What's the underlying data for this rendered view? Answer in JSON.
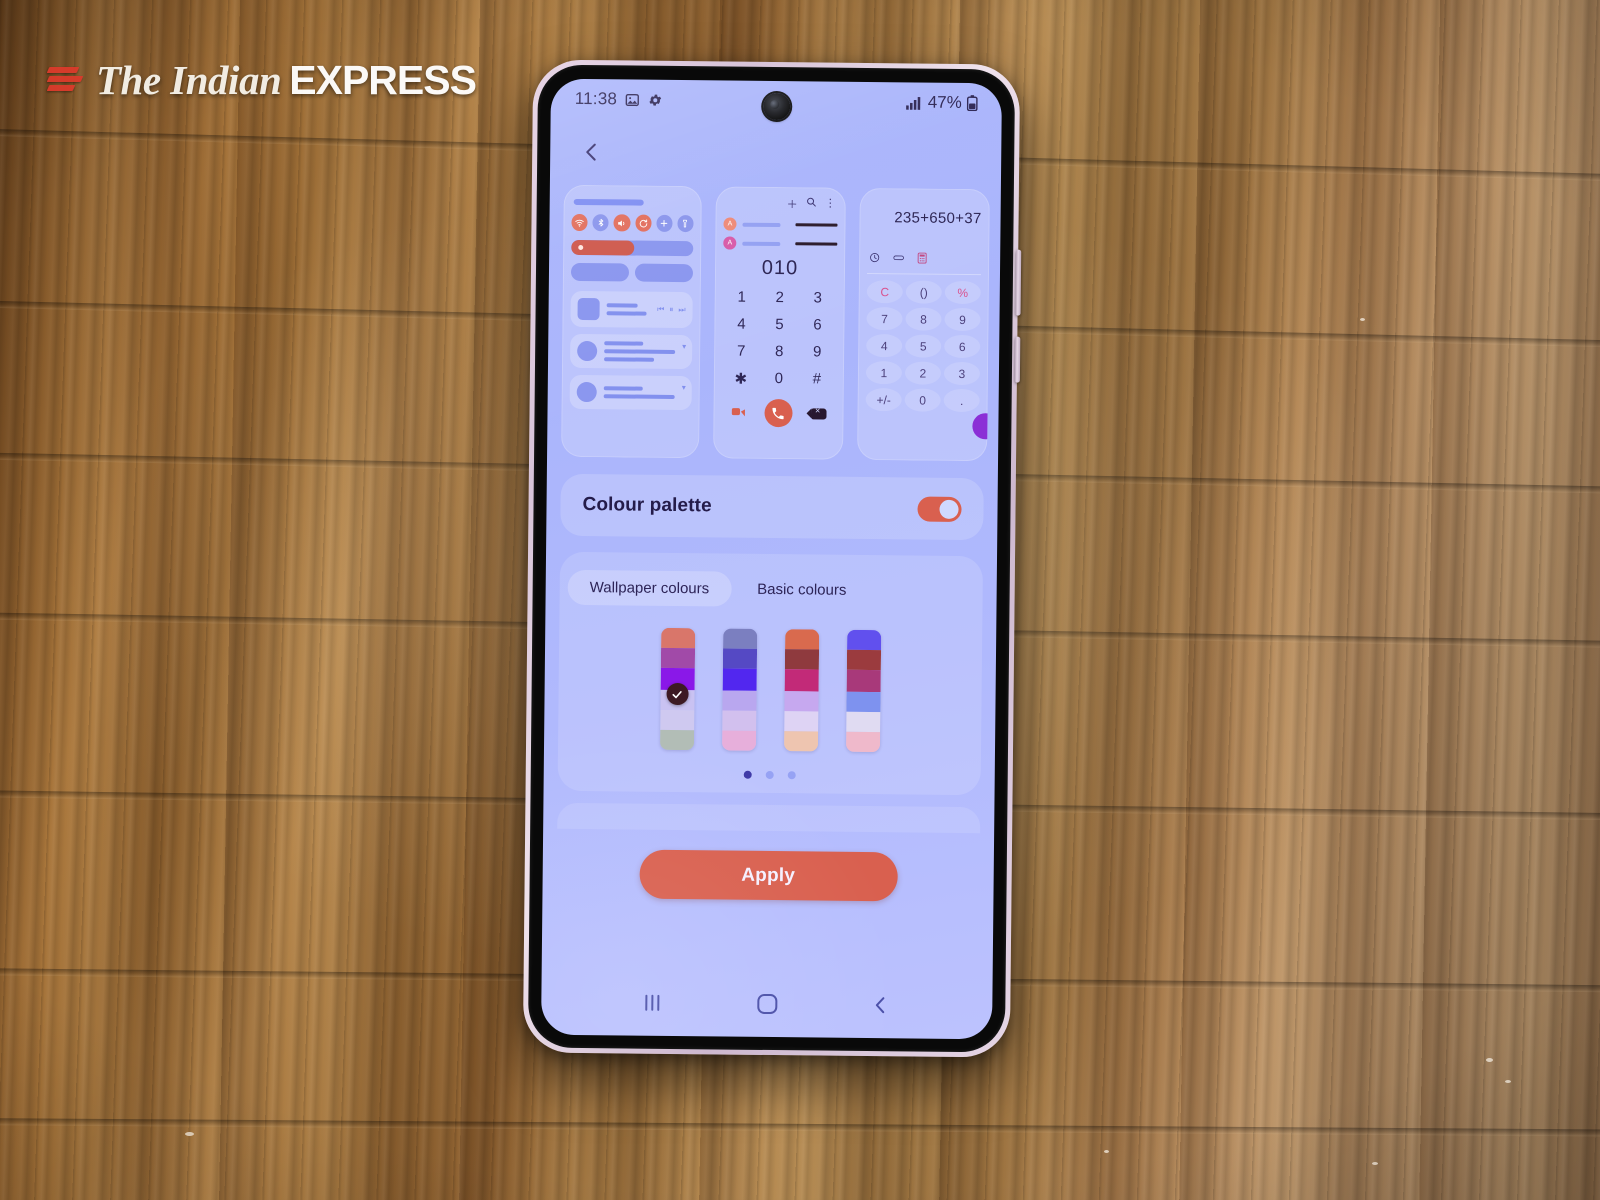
{
  "watermark": {
    "the": "The Indian",
    "express": "EXPRESS",
    "logo_icon": "indian-express-logo-icon",
    "accent": "#d93b2b"
  },
  "device": {
    "frame_color": "#e2d0e2",
    "screen_bg": "#aab5fc"
  },
  "status_bar": {
    "time": "11:38",
    "icons": [
      "image-icon",
      "gear-icon"
    ],
    "signal_icon": "signal-bars-icon",
    "battery_text": "47%",
    "battery_icon": "battery-icon",
    "camera": "front-camera-punch-hole"
  },
  "top_bar": {
    "back_icon": "chevron-left-icon"
  },
  "previews": {
    "quick_panel": {
      "name": "quick-panel-preview",
      "toggles": [
        {
          "icon": "wifi-icon",
          "color": "red"
        },
        {
          "icon": "bluetooth-icon",
          "color": "blue"
        },
        {
          "icon": "sound-icon",
          "color": "red"
        },
        {
          "icon": "sync-icon",
          "color": "red"
        },
        {
          "icon": "plus-icon",
          "color": "blue"
        },
        {
          "icon": "flashlight-icon",
          "color": "blue"
        }
      ],
      "brightness_percent": 52,
      "media_controls": [
        "prev-icon",
        "pause-icon",
        "next-icon"
      ]
    },
    "dialer": {
      "name": "dialer-preview",
      "top_icons": [
        "plus-icon",
        "search-icon",
        "more-vertical-icon"
      ],
      "contacts": [
        {
          "avatar_letter": "A",
          "color": "#ee8a78"
        },
        {
          "avatar_letter": "A",
          "color": "#d75aa8"
        }
      ],
      "number": "010",
      "keys": [
        "1",
        "2",
        "3",
        "4",
        "5",
        "6",
        "7",
        "8",
        "9",
        "✱",
        "0",
        "#"
      ],
      "actions": [
        "video-call-icon",
        "call-button",
        "backspace-icon"
      ]
    },
    "calculator": {
      "name": "calculator-preview",
      "expression": "235+650+37",
      "tools": [
        "history-icon",
        "unit-convert-icon",
        "calculator-icon"
      ],
      "keys": [
        "C",
        "()",
        "%",
        "7",
        "8",
        "9",
        "4",
        "5",
        "6",
        "1",
        "2",
        "3",
        "+/-",
        "0",
        "."
      ],
      "accent_keys": [
        "C",
        "%"
      ],
      "equals_icon": "equals-button"
    }
  },
  "colour_palette_row": {
    "label": "Colour palette",
    "toggle_on": true,
    "toggle_color": "#d9604f"
  },
  "palette_panel": {
    "tabs": [
      {
        "label": "Wallpaper colours",
        "active": true
      },
      {
        "label": "Basic colours",
        "active": false
      }
    ],
    "swatches": [
      {
        "name": "swatch-1",
        "selected": true,
        "bands": [
          "#d9766a",
          "#a14aa8",
          "#8a18e8",
          "#c9c2f2",
          "#cfc9f0",
          "#b2bdb6"
        ]
      },
      {
        "name": "swatch-2",
        "selected": false,
        "bands": [
          "#7b7fc0",
          "#5549c4",
          "#5227ef",
          "#b9a7ef",
          "#d2c0ee",
          "#e7afdb"
        ]
      },
      {
        "name": "swatch-3",
        "selected": false,
        "bands": [
          "#d96a4e",
          "#8f3a3e",
          "#c22a78",
          "#c6a8ef",
          "#ded3f4",
          "#eec5b0"
        ]
      },
      {
        "name": "swatch-4",
        "selected": false,
        "bands": [
          "#6150ee",
          "#9b3b3e",
          "#a8397a",
          "#7e92ef",
          "#e0dbf2",
          "#efb9cb"
        ]
      }
    ],
    "check_icon": "check-icon",
    "page_dots": {
      "count": 3,
      "active_index": 0
    }
  },
  "apply": {
    "label": "Apply",
    "color": "#d9604f"
  },
  "nav_bar": {
    "recents_icon": "recents-icon",
    "home_icon": "home-icon",
    "back_icon": "back-icon"
  }
}
